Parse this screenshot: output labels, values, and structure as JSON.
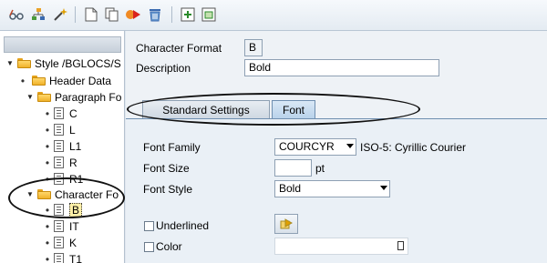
{
  "toolbar": {
    "icons": [
      "glasses-icon",
      "hierarchy-icon",
      "magic-wand-icon",
      "new-document-icon",
      "copy-icon",
      "activate-icon",
      "delete-icon",
      "add-icon",
      "frame-icon"
    ]
  },
  "tree": {
    "items": [
      {
        "label": "Style /BGLOCS/S",
        "level": 0
      },
      {
        "label": "Header Data",
        "level": 1
      },
      {
        "label": "Paragraph Fo",
        "level": 1
      },
      {
        "label": "C",
        "level": 2
      },
      {
        "label": "L",
        "level": 2
      },
      {
        "label": "L1",
        "level": 2
      },
      {
        "label": "R",
        "level": 2
      },
      {
        "label": "R1",
        "level": 2
      },
      {
        "label": "Character Fo",
        "level": 1
      },
      {
        "label": "B",
        "level": 2
      },
      {
        "label": "IT",
        "level": 2
      },
      {
        "label": "K",
        "level": 2
      },
      {
        "label": "T1",
        "level": 2
      }
    ]
  },
  "header": {
    "char_format_label": "Character Format",
    "char_format_value": "B",
    "description_label": "Description",
    "description_value": "Bold"
  },
  "tabs": {
    "standard": "Standard Settings",
    "font": "Font"
  },
  "font": {
    "family_label": "Font Family",
    "family_value": "COURCYR",
    "family_desc": "ISO-5: Cyrillic Courier",
    "size_label": "Font Size",
    "size_value": "",
    "size_unit": "pt",
    "style_label": "Font Style",
    "style_value": "Bold",
    "underlined_label": "Underlined",
    "color_label": "Color"
  },
  "colors": {
    "accent": "#b9d2ea",
    "folder": "#f0b22a",
    "background": "#eaf0f6"
  }
}
